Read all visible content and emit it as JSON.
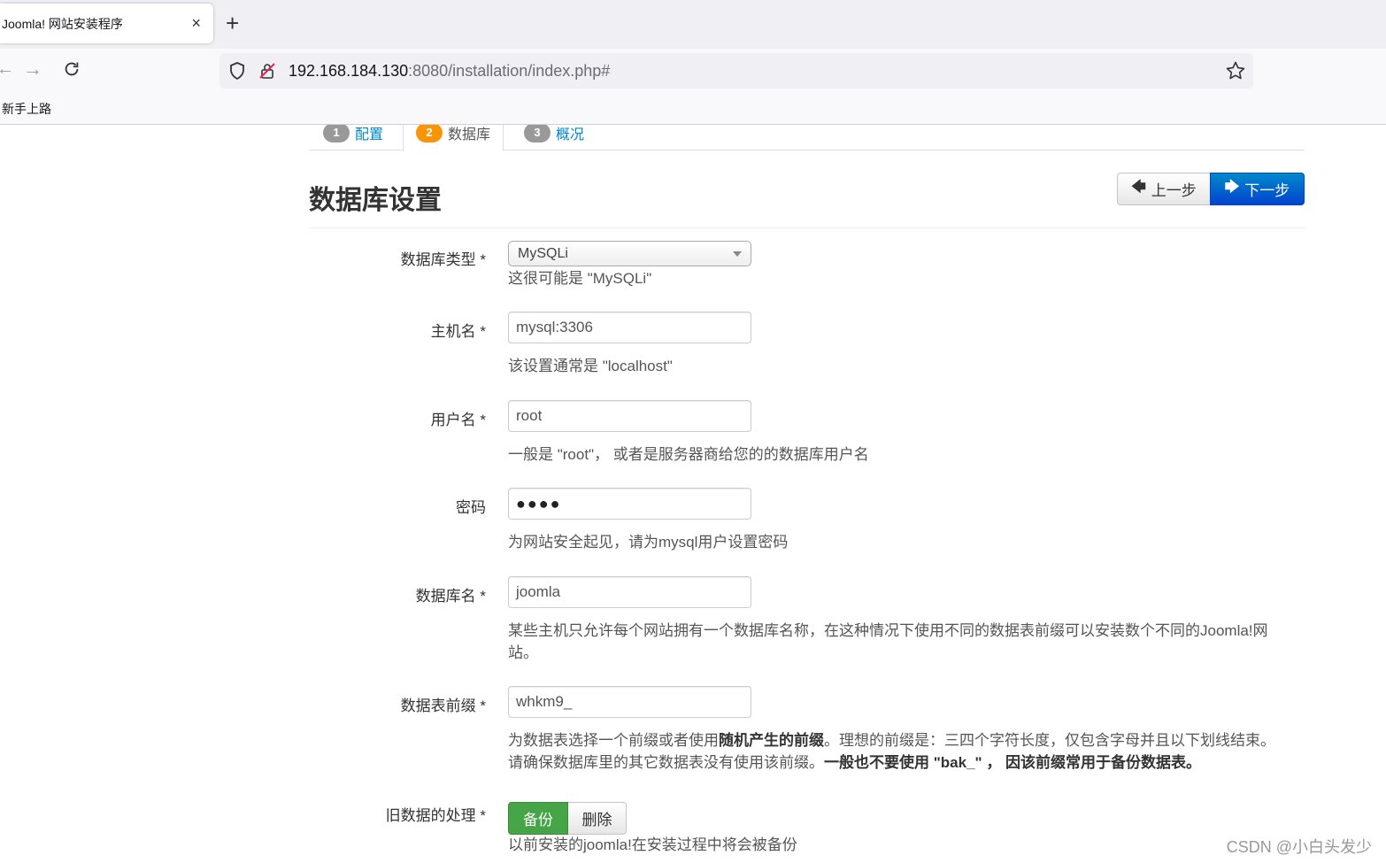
{
  "browser": {
    "tab_title": "Joomla! 网站安装程序",
    "tab_close": "×",
    "new_tab": "+",
    "url_host": "192.168.184.130",
    "url_rest": ":8080/installation/index.php#",
    "bookmark": "新手上路"
  },
  "steps": [
    {
      "num": "1",
      "label": "配置"
    },
    {
      "num": "2",
      "label": "数据库"
    },
    {
      "num": "3",
      "label": "概况"
    }
  ],
  "page_title": "数据库设置",
  "buttons": {
    "prev": "上一步",
    "next": "下一步",
    "prev_icon": "arrow-left-icon",
    "next_icon": "arrow-right-icon"
  },
  "form": {
    "db_type": {
      "label": "数据库类型 *",
      "value": "MySQLi",
      "help": "这很可能是 \"MySQLi\""
    },
    "host": {
      "label": "主机名 *",
      "value": "mysql:3306",
      "help": "该设置通常是 \"localhost\""
    },
    "user": {
      "label": "用户名 *",
      "value": "root",
      "help": "一般是 \"root\"， 或者是服务器商给您的的数据库用户名"
    },
    "password": {
      "label": "密码",
      "value": "●●●●",
      "help": "为网站安全起见，请为mysql用户设置密码"
    },
    "db_name": {
      "label": "数据库名 *",
      "value": "joomla",
      "help_line1": "某些主机只允许每个网站拥有一个数据库名称，在这种情况下使用不同的数据表前缀可以安装数个不同的Joomla!网",
      "help_line2": "站。"
    },
    "prefix": {
      "label": "数据表前缀 *",
      "value": "whkm9_",
      "help_a": "为数据表选择一个前缀或者使用",
      "help_b": "随机产生的前缀",
      "help_c": "。理想的前缀是：三四个字符长度，仅包含字母并且以下划线结束。",
      "help_d": "请确保数据库里的其它数据表没有使用该前缀。",
      "help_e": "一般也不要使用 \"bak_\" ， 因该前缀常用于备份数据表。"
    },
    "old_data": {
      "label": "旧数据的处理 *",
      "option_backup": "备份",
      "option_delete": "删除",
      "help": "以前安装的joomla!在安装过程中将会被备份"
    }
  },
  "watermark": "CSDN @小白头发少",
  "colors": {
    "accent": "#0088cc",
    "step_active": "#f89406",
    "toggle_on": "#46a546"
  }
}
